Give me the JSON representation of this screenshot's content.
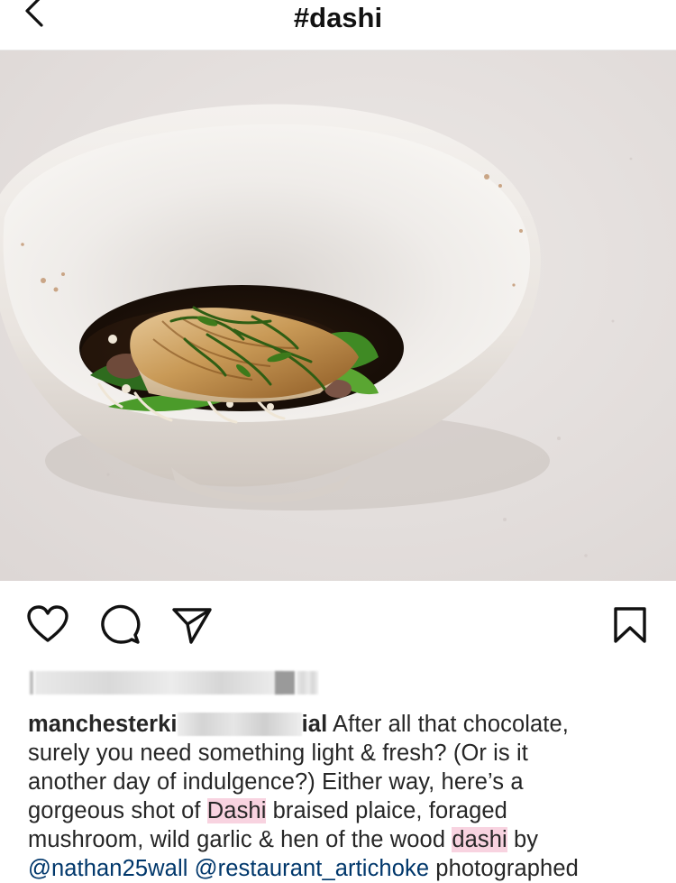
{
  "header": {
    "title": "#dashi",
    "back_icon": "chevron-left-icon"
  },
  "post": {
    "image_alt": "Braised plaice with foraged mushroom and wild garlic in dashi, in a white ceramic bowl",
    "actions": {
      "like_icon": "heart-icon",
      "comment_icon": "comment-bubble-icon",
      "share_icon": "paper-plane-icon",
      "save_icon": "bookmark-icon"
    },
    "caption": {
      "username_start": "manchesterki",
      "username_end": "ial",
      "line1_text": " After all that chocolate,",
      "line2_text": "surely you need something light & fresh? (Or is it",
      "line3_text": "another day of indulgence?) Either way, here’s a",
      "line4_a": "gorgeous shot of ",
      "line4_hl": "Dashi",
      "line4_b": " braised plaice, foraged",
      "line5_a": "mushroom, wild garlic & hen of the wood ",
      "line5_hl": "dashi",
      "line5_b": " by",
      "line6_m1": "@nathan25wall",
      "line6_m2": "@restaurant_artichoke",
      "line6_tail": " photographed"
    }
  }
}
